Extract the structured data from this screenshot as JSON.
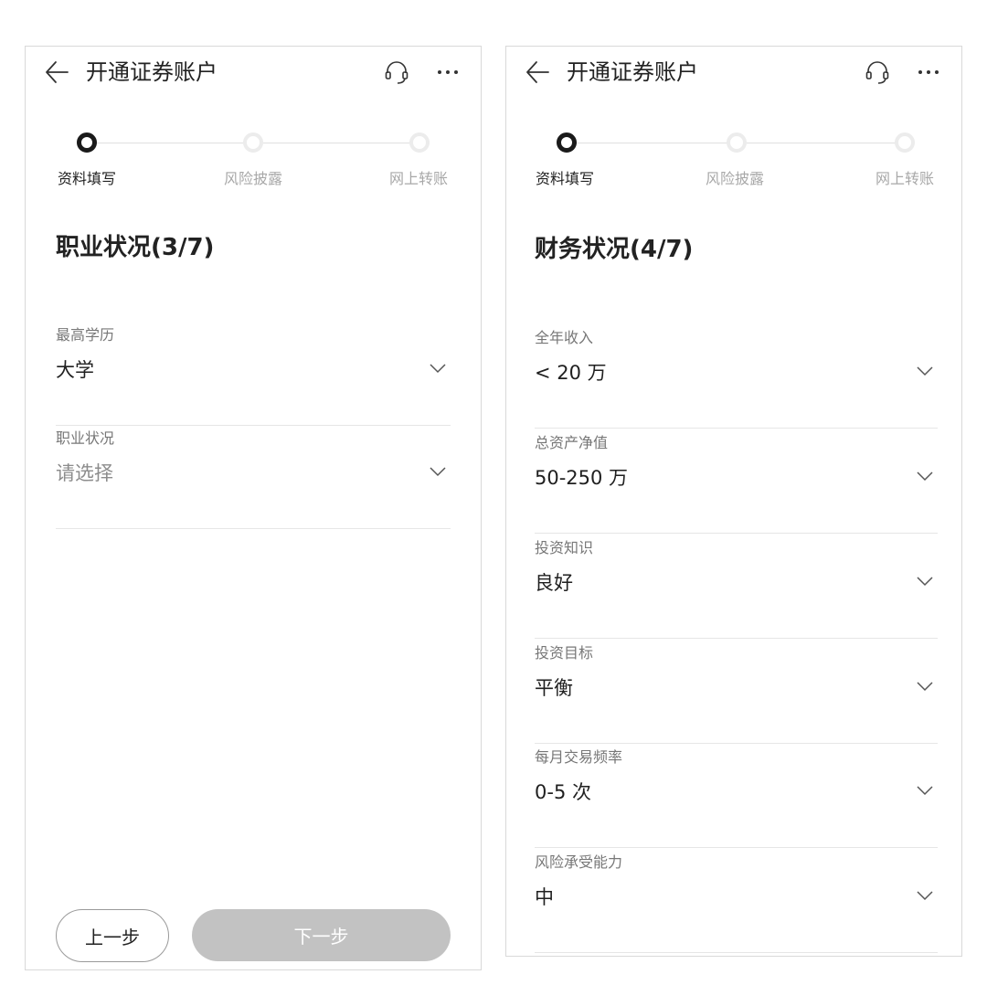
{
  "left_screen": {
    "title": "开通证券账户",
    "steps": [
      {
        "label": "资料填写",
        "state": "active"
      },
      {
        "label": "风险披露",
        "state": "inactive"
      },
      {
        "label": "网上转账",
        "state": "inactive"
      }
    ],
    "section_title": "职业状况(3/7)",
    "fields": [
      {
        "label": "最高学历",
        "value": "大学",
        "placeholder": false
      },
      {
        "label": "职业状况",
        "value": "请选择",
        "placeholder": true
      }
    ],
    "prev_button": "上一步",
    "next_button": "下一步"
  },
  "right_screen": {
    "title": "开通证券账户",
    "steps": [
      {
        "label": "资料填写",
        "state": "active"
      },
      {
        "label": "风险披露",
        "state": "inactive"
      },
      {
        "label": "网上转账",
        "state": "inactive"
      }
    ],
    "section_title": "财务状况(4/7)",
    "fields": [
      {
        "label": "全年收入",
        "value": "< 20 万"
      },
      {
        "label": "总资产净值",
        "value": "50-250 万"
      },
      {
        "label": "投资知识",
        "value": "良好"
      },
      {
        "label": "投资目标",
        "value": "平衡"
      },
      {
        "label": "每月交易频率",
        "value": "0-5 次"
      },
      {
        "label": "风险承受能力",
        "value": "中"
      }
    ]
  },
  "colors": {
    "active_step": "#1a1a1a",
    "inactive_step": "#ececec",
    "disabled_button": "#c2c2c2",
    "divider": "#e6e6e6"
  },
  "icons": [
    "back-arrow-icon",
    "headset-icon",
    "more-icon",
    "chevron-down-icon"
  ]
}
